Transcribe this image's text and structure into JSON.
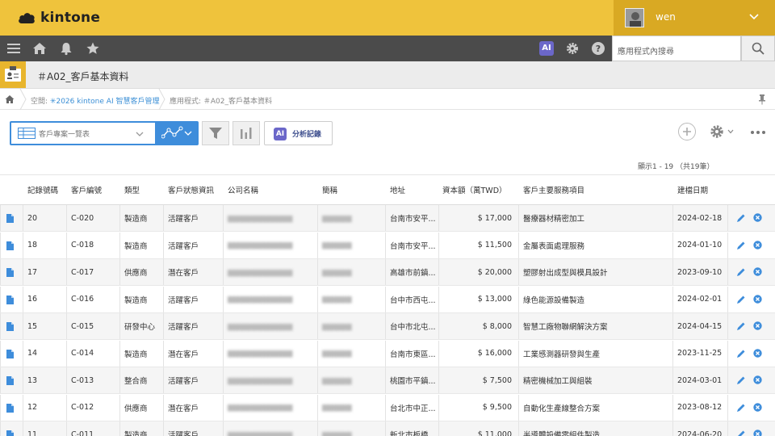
{
  "app": {
    "logo_text": "kintone",
    "username": "wen",
    "app_title": "＃A02_客戶基本資料",
    "search_placeholder": "應用程式內搜尋"
  },
  "breadcrumb": {
    "space_prefix": "空間:",
    "space_link": "✳2026 kintone AI 智慧客戶管理",
    "app_crumb": "應用程式: ＃A02_客戶基本資料"
  },
  "toolbar": {
    "view_name": "客戶專案一覽表",
    "analysis_ai": "AI",
    "analysis_label": "分析記錄",
    "nav_ai": "AI",
    "count_text": "顯示1 - 19 （共19筆）"
  },
  "table": {
    "headers": [
      "記錄號碼",
      "客戶編號",
      "類型",
      "客戶狀態資訊",
      "公司名稱",
      "簡稱",
      "地址",
      "資本額（萬TWD）",
      "客戶主要服務項目",
      "建檔日期"
    ],
    "rows": [
      [
        "20",
        "C-020",
        "製造商",
        "活躍客戶",
        "",
        "",
        "台南市安平...",
        "$ 17,000",
        "醫療器材精密加工",
        "2024-02-18"
      ],
      [
        "18",
        "C-018",
        "製造商",
        "活躍客戶",
        "",
        "",
        "台南市安平...",
        "$ 11,500",
        "金屬表面處理服務",
        "2024-01-10"
      ],
      [
        "17",
        "C-017",
        "供應商",
        "潛在客戶",
        "",
        "",
        "高雄市前鎮...",
        "$ 20,000",
        "塑膠射出成型與模具設計",
        "2023-09-10"
      ],
      [
        "16",
        "C-016",
        "製造商",
        "活躍客戶",
        "",
        "",
        "台中市西屯...",
        "$ 13,000",
        "綠色能源設備製造",
        "2024-02-01"
      ],
      [
        "15",
        "C-015",
        "研發中心",
        "活躍客戶",
        "",
        "",
        "台中市北屯...",
        "$ 8,000",
        "智慧工廠物聯網解決方案",
        "2024-04-15"
      ],
      [
        "14",
        "C-014",
        "製造商",
        "潛在客戶",
        "",
        "",
        "台南市東區...",
        "$ 16,000",
        "工業感測器研發與生產",
        "2023-11-25"
      ],
      [
        "13",
        "C-013",
        "整合商",
        "活躍客戶",
        "",
        "",
        "桃園市平鎮...",
        "$ 7,500",
        "精密機械加工與組裝",
        "2024-03-01"
      ],
      [
        "12",
        "C-012",
        "供應商",
        "潛在客戶",
        "",
        "",
        "台北市中正...",
        "$ 9,500",
        "自動化生產線整合方案",
        "2023-08-12"
      ],
      [
        "11",
        "C-011",
        "製造商",
        "活躍客戶",
        "",
        "",
        "新北市板橋",
        "$ 11,000",
        "半導體設備零組件製造",
        "2024-06-20"
      ]
    ]
  },
  "colors": {
    "header_yellow": "#efc33c",
    "nav_dark": "#4b4b4b",
    "view_blue": "#3e8ddb",
    "ai_purple": "#6b67c9",
    "link_blue": "#3b8fd6"
  }
}
